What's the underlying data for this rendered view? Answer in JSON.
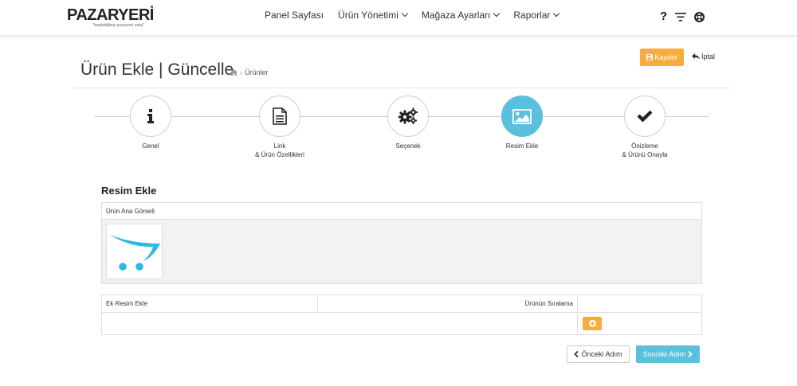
{
  "header": {
    "logo_text": "PAZARYERİ",
    "logo_tagline": "\"kaydettiğiniz pazaryeri satış\"",
    "nav": [
      {
        "label": "Panel Sayfası",
        "has_dropdown": false
      },
      {
        "label": "Ürün Yönetimi",
        "has_dropdown": true
      },
      {
        "label": "Mağaza Ayarları",
        "has_dropdown": true
      },
      {
        "label": "Raporlar",
        "has_dropdown": true
      }
    ],
    "help_label": "?",
    "icons": [
      "help-icon",
      "filter-icon",
      "lifebuoy-icon"
    ]
  },
  "page": {
    "title": "Ürün Ekle | Güncelle",
    "breadcrumb_home_icon": "home-icon",
    "breadcrumb_sep": "›",
    "breadcrumb_current": "Ürünler",
    "save_label": "Kaydet",
    "cancel_label": "İptal"
  },
  "wizard": {
    "steps": [
      {
        "label_line1": "Genel",
        "label_line2": "",
        "icon": "info-icon",
        "active": false
      },
      {
        "label_line1": "Link",
        "label_line2": "& Ürün Özellikleri",
        "icon": "document-icon",
        "active": false
      },
      {
        "label_line1": "Seçenek",
        "label_line2": "",
        "icon": "gears-icon",
        "active": false
      },
      {
        "label_line1": "Resim Ekle",
        "label_line2": "",
        "icon": "image-icon",
        "active": true
      },
      {
        "label_line1": "Önizleme",
        "label_line2": "& Ürünü Onayla",
        "icon": "check-icon",
        "active": false
      }
    ]
  },
  "images": {
    "section_title": "Resim Ekle",
    "main_image_header": "Ürün Ana Görseli",
    "extra_header": "Ek Resim Ekle",
    "sort_header": "Ürünün Sıralama"
  },
  "footer": {
    "prev_label": "Önceki Adım",
    "next_label": "Sonraki Adım"
  },
  "colors": {
    "accent_orange": "#f8ac3c",
    "accent_blue": "#5bc0de"
  }
}
